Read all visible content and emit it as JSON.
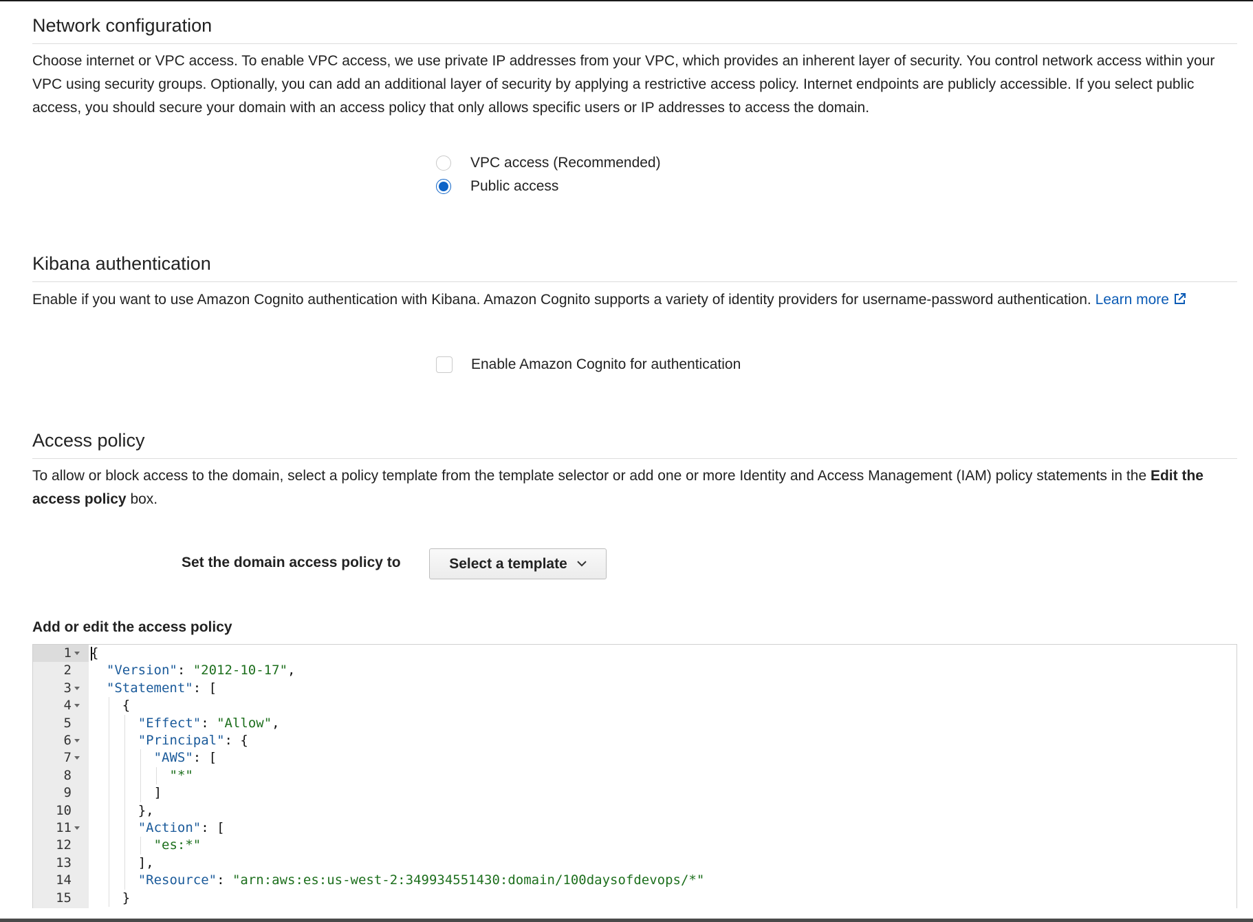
{
  "network": {
    "title": "Network configuration",
    "description": "Choose internet or VPC access. To enable VPC access, we use private IP addresses from your VPC, which provides an inherent layer of security. You control network access within your VPC using security groups. Optionally, you can add an additional layer of security by applying a restrictive access policy. Internet endpoints are publicly accessible. If you select public access, you should secure your domain with an access policy that only allows specific users or IP addresses to access the domain.",
    "options": [
      {
        "label": "VPC access (Recommended)",
        "selected": false
      },
      {
        "label": "Public access",
        "selected": true
      }
    ]
  },
  "kibana": {
    "title": "Kibana authentication",
    "description": "Enable if you want to use Amazon Cognito authentication with Kibana. Amazon Cognito supports a variety of identity providers for username-password authentication.",
    "learn_more": "Learn more",
    "checkbox_label": "Enable Amazon Cognito for authentication",
    "checkbox_checked": false
  },
  "access_policy": {
    "title": "Access policy",
    "description_pre": "To allow or block access to the domain, select a policy template from the template selector or add one or more Identity and Access Management (IAM) policy statements in the",
    "description_bold": "Edit the access policy",
    "description_post": "box.",
    "set_label": "Set the domain access policy to",
    "template_button": "Select a template",
    "editor_title": "Add or edit the access policy"
  },
  "editor": {
    "line_numbers": [
      "1",
      "2",
      "3",
      "4",
      "5",
      "6",
      "7",
      "8",
      "9",
      "10",
      "11",
      "12",
      "13",
      "14",
      "15"
    ],
    "lines": [
      {
        "p1": "{"
      },
      {
        "k": "\"Version\"",
        "p1": ": ",
        "s": "\"2012-10-17\"",
        "p2": ","
      },
      {
        "k": "\"Statement\"",
        "p1": ": ["
      },
      {
        "p1": "{"
      },
      {
        "k": "\"Effect\"",
        "p1": ": ",
        "s": "\"Allow\"",
        "p2": ","
      },
      {
        "k": "\"Principal\"",
        "p1": ": {"
      },
      {
        "k": "\"AWS\"",
        "p1": ": ["
      },
      {
        "s": "\"*\""
      },
      {
        "p1": "]"
      },
      {
        "p1": "},"
      },
      {
        "k": "\"Action\"",
        "p1": ": ["
      },
      {
        "s": "\"es:*\""
      },
      {
        "p1": "],"
      },
      {
        "k": "\"Resource\"",
        "p1": ": ",
        "s": "\"arn:aws:es:us-west-2:349934551430:domain/100daysofdevops/*\""
      },
      {
        "p1": "}"
      }
    ]
  }
}
